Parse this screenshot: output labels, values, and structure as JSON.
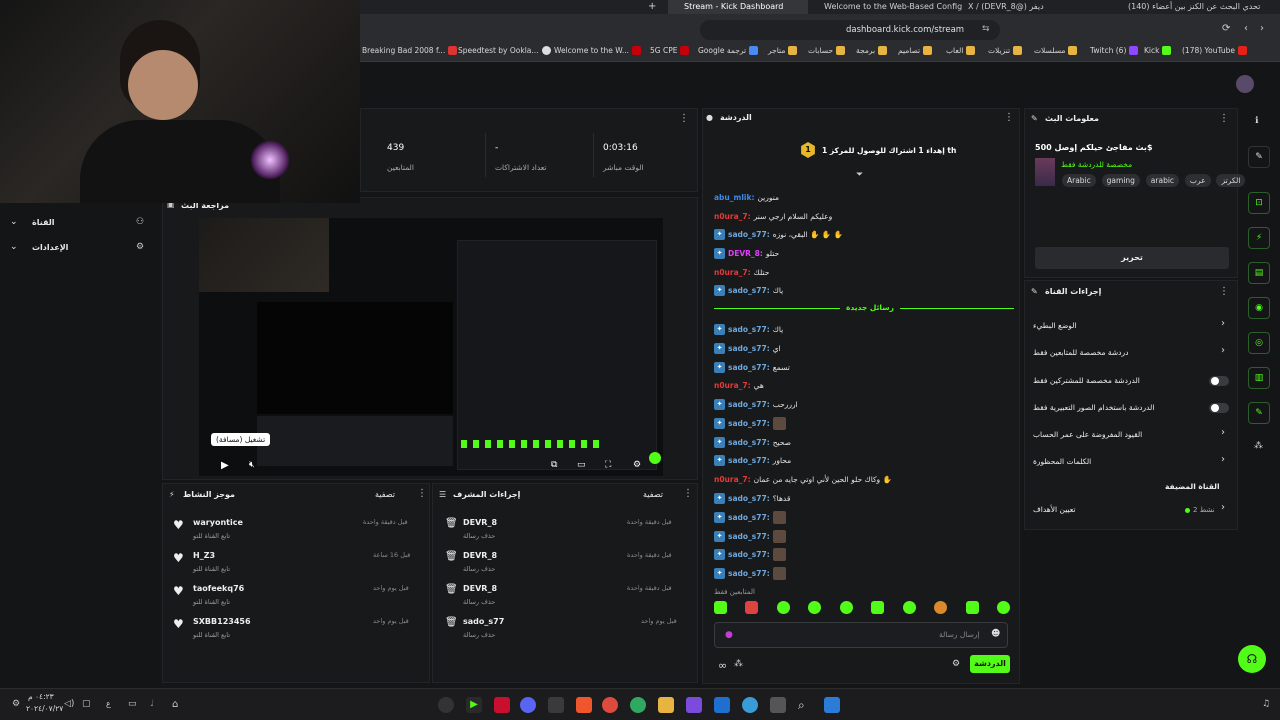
{
  "browser": {
    "tabs": [
      {
        "label": "(140) تحدي البحث عن الكنز بين أعضاء"
      },
      {
        "label": "X / (DEVR_8@) ديفر"
      },
      {
        "label": "Welcome to the Web-Based Config:"
      },
      {
        "label": "Stream - Kick Dashboard"
      }
    ],
    "new_tab": "+",
    "url": "dashboard.kick.com/stream",
    "bookmarks": [
      "(178) YouTube",
      "Kick",
      "Twitch (6)",
      "مسلسلات",
      "تنزيلات",
      "العاب",
      "تصاميم",
      "برمجة",
      "حسابات",
      "متاجر",
      "Google ترجمة",
      "5G CPE",
      "Welcome to the W...",
      "Speedtest by Ookla...",
      "Breaking Bad 2008 f..."
    ]
  },
  "left_nav": {
    "channel": "القناة",
    "settings": "الإعدادات"
  },
  "stats": [
    {
      "value": "0:03:16",
      "label": "الوقت مباشر"
    },
    {
      "value": "-",
      "label": "تعداد الاشتراكات"
    },
    {
      "value": "439",
      "label": "المتابعين"
    }
  ],
  "preview": {
    "title": "مراجعة البث",
    "tooltip": "تشغيل (مسافة)"
  },
  "activity": {
    "title": "موجز النشاط",
    "filter": "تصفية",
    "items": [
      {
        "name": "waryontice",
        "sub": "تابع القناة للتو",
        "time": "قبل دقيقة واحدة"
      },
      {
        "name": "H_Z3",
        "sub": "تابع القناة للتو",
        "time": "قبل 16 ساعة"
      },
      {
        "name": "taofeekq76",
        "sub": "تابع القناة للتو",
        "time": "قبل يوم واحد"
      },
      {
        "name": "SXBB123456",
        "sub": "تابع القناة للتو",
        "time": "قبل يوم واحد"
      }
    ]
  },
  "mod": {
    "title": "إجراءات المشرف",
    "filter": "تصفية",
    "items": [
      {
        "name": "DEVR_8",
        "sub": "حذف رسالة",
        "time": "قبل دقيقة واحدة"
      },
      {
        "name": "DEVR_8",
        "sub": "حذف رسالة",
        "time": "قبل دقيقة واحدة"
      },
      {
        "name": "DEVR_8",
        "sub": "حذف رسالة",
        "time": "قبل دقيقة واحدة"
      },
      {
        "name": "sado_s77",
        "sub": "حذف رسالة",
        "time": "قبل يوم واحد"
      }
    ]
  },
  "chat": {
    "title": "الدردشة",
    "pinned": "إهداء 1 اشتراك للوصول للمركز 1 th",
    "pinned_rank": "1",
    "new_messages": "رسائل جديدة",
    "messages": [
      {
        "user": "abu_mlik:",
        "text": "منورين",
        "color": "#3b8beb",
        "badge": false,
        "emote": false
      },
      {
        "user": "n0ura_7:",
        "text": "وعليكم السلام ارجي سنر",
        "color": "#e53a3a",
        "badge": false,
        "emote": false
      },
      {
        "user": "sado_s77:",
        "text": "البقي، نوزه ✋ ✋ ✋",
        "color": "#6fa8dc",
        "badge": true,
        "emote": false
      },
      {
        "user": "DEVR_8:",
        "text": "حتلو",
        "color": "#e040fb",
        "badge": true,
        "emote": false
      },
      {
        "user": "n0ura_7:",
        "text": "حتلك",
        "color": "#e53a3a",
        "badge": false,
        "emote": false
      },
      {
        "user": "sado_s77:",
        "text": "ياك",
        "color": "#6fa8dc",
        "badge": true,
        "emote": false
      },
      {
        "user": "sado_s77:",
        "text": "ياك",
        "color": "#6fa8dc",
        "badge": true,
        "emote": false
      },
      {
        "user": "sado_s77:",
        "text": "اي",
        "color": "#6fa8dc",
        "badge": true,
        "emote": false
      },
      {
        "user": "sado_s77:",
        "text": "تسمع",
        "color": "#6fa8dc",
        "badge": true,
        "emote": false
      },
      {
        "user": "n0ura_7:",
        "text": "هي",
        "color": "#e53a3a",
        "badge": false,
        "emote": false
      },
      {
        "user": "sado_s77:",
        "text": "ارررحب",
        "color": "#6fa8dc",
        "badge": true,
        "emote": false
      },
      {
        "user": "sado_s77:",
        "text": "",
        "color": "#6fa8dc",
        "badge": true,
        "emote": true
      },
      {
        "user": "sado_s77:",
        "text": "صحيح",
        "color": "#6fa8dc",
        "badge": true,
        "emote": false
      },
      {
        "user": "sado_s77:",
        "text": "محاور",
        "color": "#6fa8dc",
        "badge": true,
        "emote": false
      },
      {
        "user": "n0ura_7:",
        "text": "وكاك حلو الحين لأني اوتي جايه من عمان ✋",
        "color": "#e53a3a",
        "badge": false,
        "emote": false
      },
      {
        "user": "sado_s77:",
        "text": "قدها؟",
        "color": "#6fa8dc",
        "badge": true,
        "emote": false
      },
      {
        "user": "sado_s77:",
        "text": "",
        "color": "#6fa8dc",
        "badge": true,
        "emote": true
      },
      {
        "user": "sado_s77:",
        "text": "",
        "color": "#6fa8dc",
        "badge": true,
        "emote": true
      },
      {
        "user": "sado_s77:",
        "text": "",
        "color": "#6fa8dc",
        "badge": true,
        "emote": true
      },
      {
        "user": "sado_s77:",
        "text": "",
        "color": "#6fa8dc",
        "badge": true,
        "emote": true
      }
    ],
    "followers_only": "المتابعين فقط",
    "input_placeholder": "إرسال رسالة",
    "send": "الدردشة"
  },
  "stream_info": {
    "title": "معلومات البث",
    "stream_title": "بث مفاجئ حيلكم إوصل 500$",
    "subtitle": "مخصصة للدردشة فقط",
    "tags": [
      "الكرتز",
      "عرب",
      "arabic",
      "gaming",
      "Arabic"
    ],
    "edit": "تحرير"
  },
  "channel_actions": {
    "title": "إجراءات القناة",
    "rows": [
      {
        "label": "الوضع البطيء",
        "type": "chevron"
      },
      {
        "label": "دردشة مخصصة للمتابعين فقط",
        "type": "chevron"
      },
      {
        "label": "الدردشة مخصصة للمشتركين فقط",
        "type": "toggle"
      },
      {
        "label": "الدردشة باستخدام الصور التعبيرية فقط",
        "type": "toggle"
      },
      {
        "label": "القيود المفروضة على عمر الحساب",
        "type": "chevron"
      },
      {
        "label": "الكلمات المحظورة",
        "type": "chevron"
      }
    ],
    "targets_section": "القناة المضيفة",
    "goals": "تعيين الأهداف",
    "goals_count": "نشط 2"
  },
  "taskbar": {
    "time": "٠٤:٢٣ م",
    "date": "٢٠٢٤/٠٧/٢٧",
    "lang": "ع"
  },
  "colors": {
    "kick_green": "#53fc18",
    "bg": "#141517",
    "panel": "#18191b"
  }
}
